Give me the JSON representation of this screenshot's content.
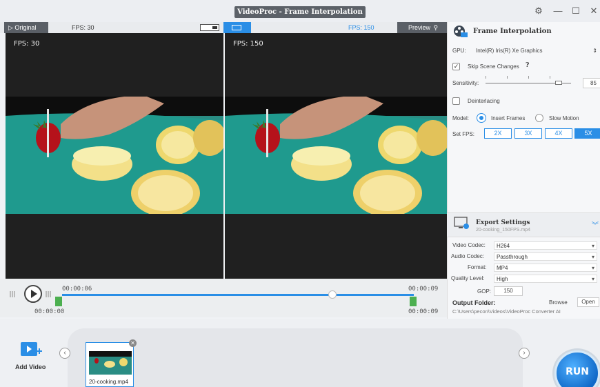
{
  "window": {
    "title": "VideoProc - Frame Interpolation",
    "controls": [
      "settings-icon",
      "minimize-icon",
      "maximize-icon",
      "close-icon"
    ]
  },
  "preview": {
    "original_tab": "▷ Original",
    "fps_left": "FPS: 30",
    "fps_right": "FPS: 150",
    "preview_tab": "Preview",
    "left_overlay": "FPS: 30",
    "right_overlay": "FPS: 150"
  },
  "timeline": {
    "start_time": "00:00:00",
    "current_time": "00:00:06",
    "end_time_top": "00:00:09",
    "end_time_bottom": "00:00:09",
    "progress": 0.76
  },
  "frame_interpolation": {
    "title": "Frame Interpolation",
    "gpu_label": "GPU:",
    "gpu_value": "Intel(R) Iris(R) Xe Graphics",
    "skip_scene_label": "Skip Scene Changes",
    "skip_scene_help": "?",
    "skip_scene_checked": true,
    "sensitivity_label": "Sensitivity:",
    "sensitivity_value": "85",
    "sensitivity_level": 0.85,
    "deinterlacing_label": "Deinterlacing",
    "deinterlacing_checked": false,
    "model_label": "Model:",
    "model_options": [
      "Insert Frames",
      "Slow Motion"
    ],
    "model_selected": "Insert Frames",
    "setfps_label": "Set FPS:",
    "fps_buttons": [
      "2X",
      "3X",
      "4X",
      "5X"
    ],
    "fps_selected": "5X"
  },
  "export_settings": {
    "title": "Export Settings",
    "filename": "20-cooking_150FPS.mp4",
    "video_codec_label": "Video Codec:",
    "video_codec": "H264",
    "audio_codec_label": "Audio Codec:",
    "audio_codec": "Passthrough",
    "format_label": "Format:",
    "format": "MP4",
    "quality_label": "Quality Level:",
    "quality": "High",
    "gop_label": "GOP:",
    "gop": "150",
    "output_folder_label": "Output Folder:",
    "browse_label": "Browse",
    "open_label": "Open",
    "output_path": "C:\\Users\\pecon\\Videos\\VideoProc Converter AI"
  },
  "bottom": {
    "add_video_label": "Add Video",
    "thumbnail_name": "20-cooking.mp4",
    "run_label": "RUN"
  },
  "colors": {
    "accent": "#2a8ee6",
    "title_bg": "#5c6168",
    "video_bg": "#202020",
    "green_marker": "#4caf50"
  }
}
